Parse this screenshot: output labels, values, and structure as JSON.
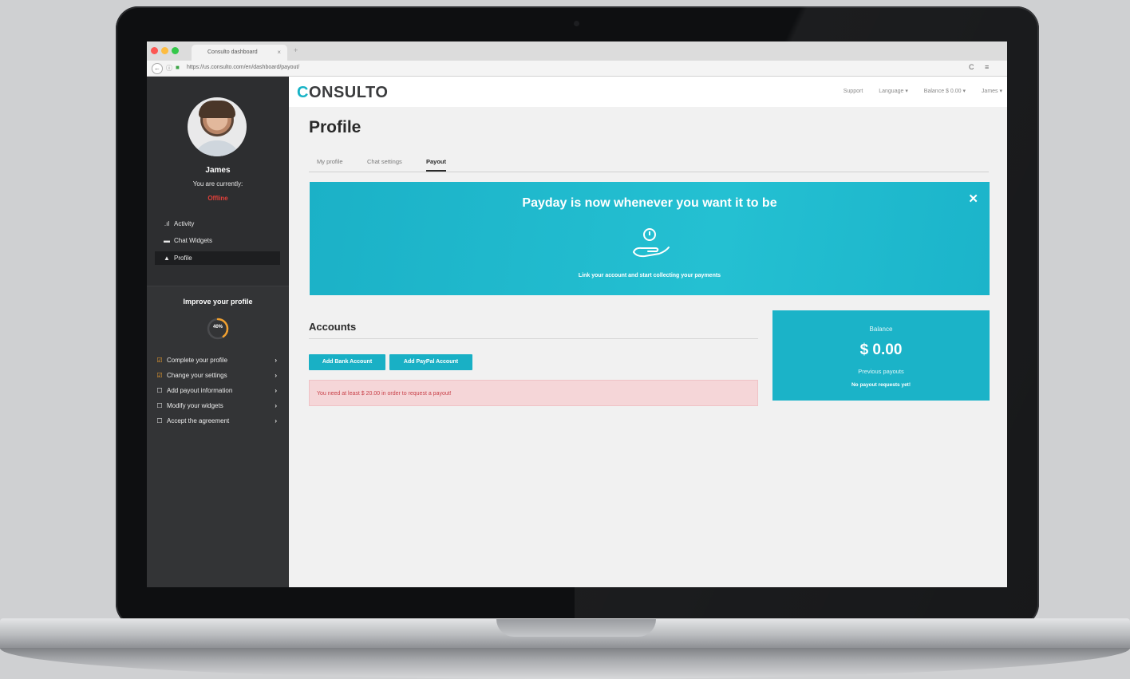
{
  "browser": {
    "tab_title": "Consulto dashboard",
    "tab_close": "×",
    "new_tab": "+",
    "back": "←",
    "url": "https://us.consulto.com/en/dashboard/payout/",
    "reload": "C",
    "menu": "≡"
  },
  "sidebar": {
    "user_name": "James",
    "status_label": "You are currently:",
    "status_value": "Offline",
    "nav": [
      {
        "icon": "bar-chart-icon",
        "glyph": ".ıl",
        "label": "Activity"
      },
      {
        "icon": "chat-icon",
        "glyph": "▬",
        "label": "Chat Widgets"
      },
      {
        "icon": "user-icon",
        "glyph": "▲",
        "label": "Profile"
      }
    ],
    "improve": {
      "title": "Improve your profile",
      "progress_text": "40%",
      "progress": 0.4,
      "tasks": [
        {
          "label": "Complete your profile",
          "done": true
        },
        {
          "label": "Change your settings",
          "done": true
        },
        {
          "label": "Add payout information",
          "done": false
        },
        {
          "label": "Modify your widgets",
          "done": false
        },
        {
          "label": "Accept the agreement",
          "done": false
        }
      ]
    }
  },
  "topnav": {
    "logo_c": "C",
    "logo_rest": "ONSULTO",
    "links": [
      "Support",
      "Language ▾",
      "Balance $ 0.00 ▾",
      "James ▾"
    ]
  },
  "page": {
    "title": "Profile",
    "tabs": [
      "My profile",
      "Chat settings",
      "Payout"
    ],
    "active_tab": "Payout"
  },
  "banner": {
    "title": "Payday is now whenever you want it to be",
    "close": "✕",
    "subtitle": "Link your account and start collecting your payments"
  },
  "accounts": {
    "title": "Accounts",
    "add_bank": "Add Bank Account",
    "add_paypal": "Add PayPal Account",
    "alert": "You need at least $ 20.00 in order to request a payout!"
  },
  "balance": {
    "label": "Balance",
    "value": "$ 0.00",
    "previous_label": "Previous payouts",
    "previous_none": "No payout requests yet!"
  },
  "colors": {
    "accent": "#19b0c5",
    "sidebar": "#2d2e30",
    "offline": "#e0403a",
    "task_done": "#f0a030",
    "alert_bg": "#f5d6d8"
  }
}
